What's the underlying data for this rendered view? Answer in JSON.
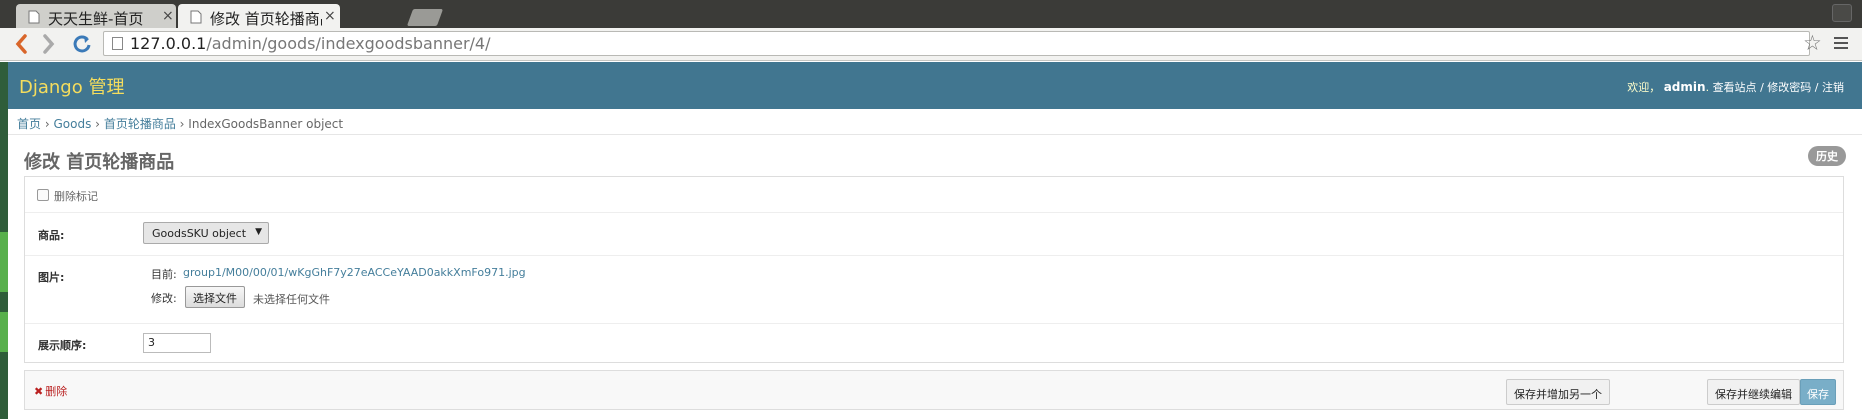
{
  "browser": {
    "tabs": [
      {
        "title": "天天生鲜-首页",
        "active": false
      },
      {
        "title": "修改 首页轮播商品 | D",
        "active": true
      }
    ],
    "url_host": "127.0.0.1",
    "url_path": "/admin/goods/indexgoodsbanner/4/",
    "close_glyph": "×"
  },
  "admin": {
    "branding": "Django 管理",
    "user_tools": {
      "welcome": "欢迎，",
      "username": "admin",
      "view_site": "查看站点",
      "change_password": "修改密码",
      "logout": "注销",
      "separator": "/"
    },
    "breadcrumbs": [
      "首页",
      "Goods",
      "首页轮播商品",
      "IndexGoodsBanner object"
    ],
    "breadcrumb_sep": "›"
  },
  "form": {
    "title": "修改 首页轮播商品",
    "history_button": "历史",
    "delete_mark_label": "删除标记",
    "goods_label": "商品:",
    "goods_selected": "GoodsSKU object",
    "image_label": "图片:",
    "image_current_label": "目前:",
    "image_current_value": "group1/M00/00/01/wKgGhF7y27eACCeYAAD0akkXmFo971.jpg",
    "image_change_label": "修改:",
    "file_button": "选择文件",
    "file_none": "未选择任何文件",
    "order_label": "展示顺序:",
    "order_value": "3"
  },
  "submit": {
    "delete_link": "删除",
    "save_add_another": "保存并增加另一个",
    "save_continue": "保存并继续编辑",
    "save": "保存"
  },
  "colors": {
    "header_bg": "#417690",
    "branding": "#f5dd5d",
    "link": "#447e9b",
    "delete": "#ba2121",
    "save_button": "#79aec8"
  }
}
